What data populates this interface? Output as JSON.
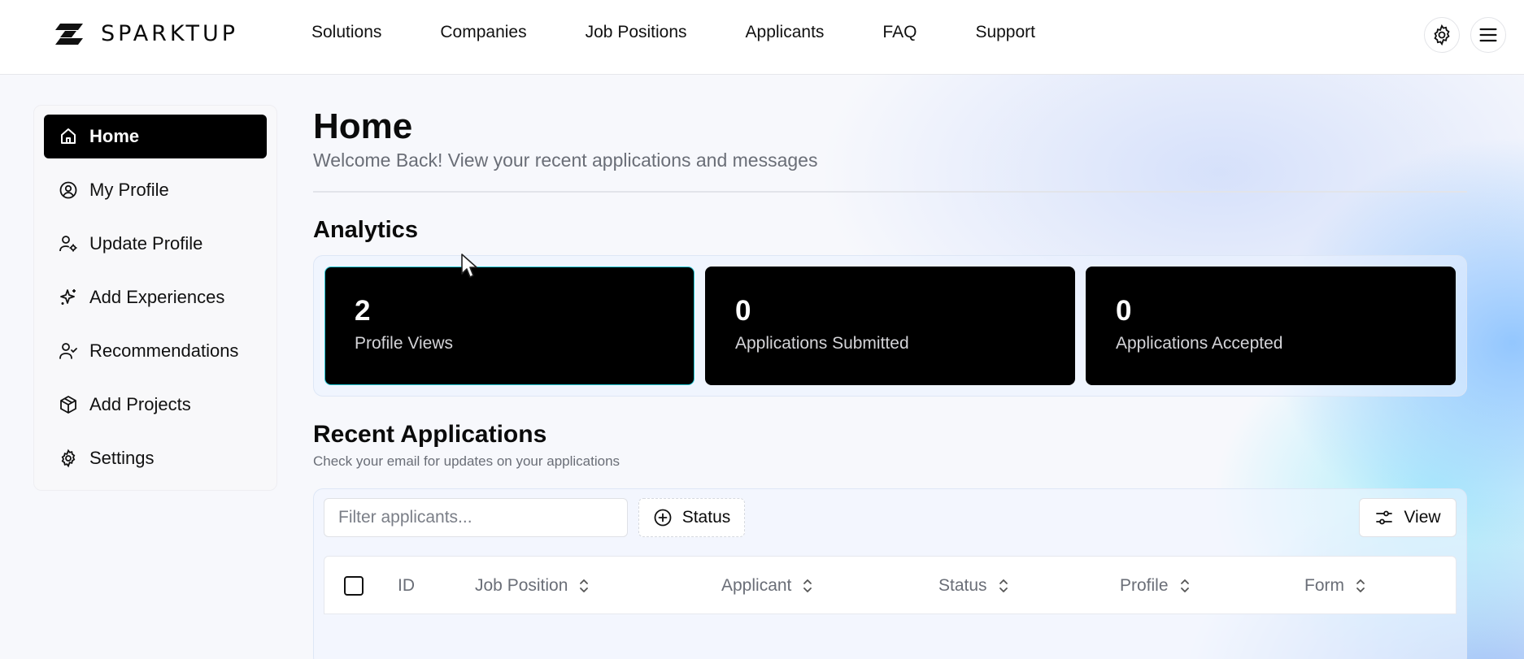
{
  "brand": {
    "name": "SPARKTUP"
  },
  "nav": {
    "items": [
      {
        "label": "Solutions"
      },
      {
        "label": "Companies"
      },
      {
        "label": "Job Positions"
      },
      {
        "label": "Applicants"
      },
      {
        "label": "FAQ"
      },
      {
        "label": "Support"
      }
    ],
    "settings_icon": "gear-icon",
    "menu_icon": "hamburger-menu-icon"
  },
  "sidebar": {
    "items": [
      {
        "label": "Home",
        "icon": "home-icon",
        "active": true
      },
      {
        "label": "My Profile",
        "icon": "user-circle-icon"
      },
      {
        "label": "Update Profile",
        "icon": "user-cog-icon"
      },
      {
        "label": "Add Experiences",
        "icon": "sparkles-icon"
      },
      {
        "label": "Recommendations",
        "icon": "user-check-icon"
      },
      {
        "label": "Add Projects",
        "icon": "package-icon"
      },
      {
        "label": "Settings",
        "icon": "gear-icon"
      }
    ]
  },
  "page": {
    "title": "Home",
    "subtitle": "Welcome Back! View your recent applications and messages"
  },
  "analytics": {
    "title": "Analytics",
    "stats": [
      {
        "value": "2",
        "label": "Profile Views"
      },
      {
        "value": "0",
        "label": "Applications Submitted"
      },
      {
        "value": "0",
        "label": "Applications Accepted"
      }
    ]
  },
  "recent": {
    "title": "Recent Applications",
    "subtitle": "Check your email for updates on your applications",
    "filter_placeholder": "Filter applicants...",
    "status_label": "Status",
    "view_label": "View",
    "columns": [
      "ID",
      "Job Position",
      "Applicant",
      "Status",
      "Profile",
      "Form"
    ]
  },
  "colors": {
    "accent_highlight": "#22c7d4",
    "active_bg": "#000000"
  }
}
